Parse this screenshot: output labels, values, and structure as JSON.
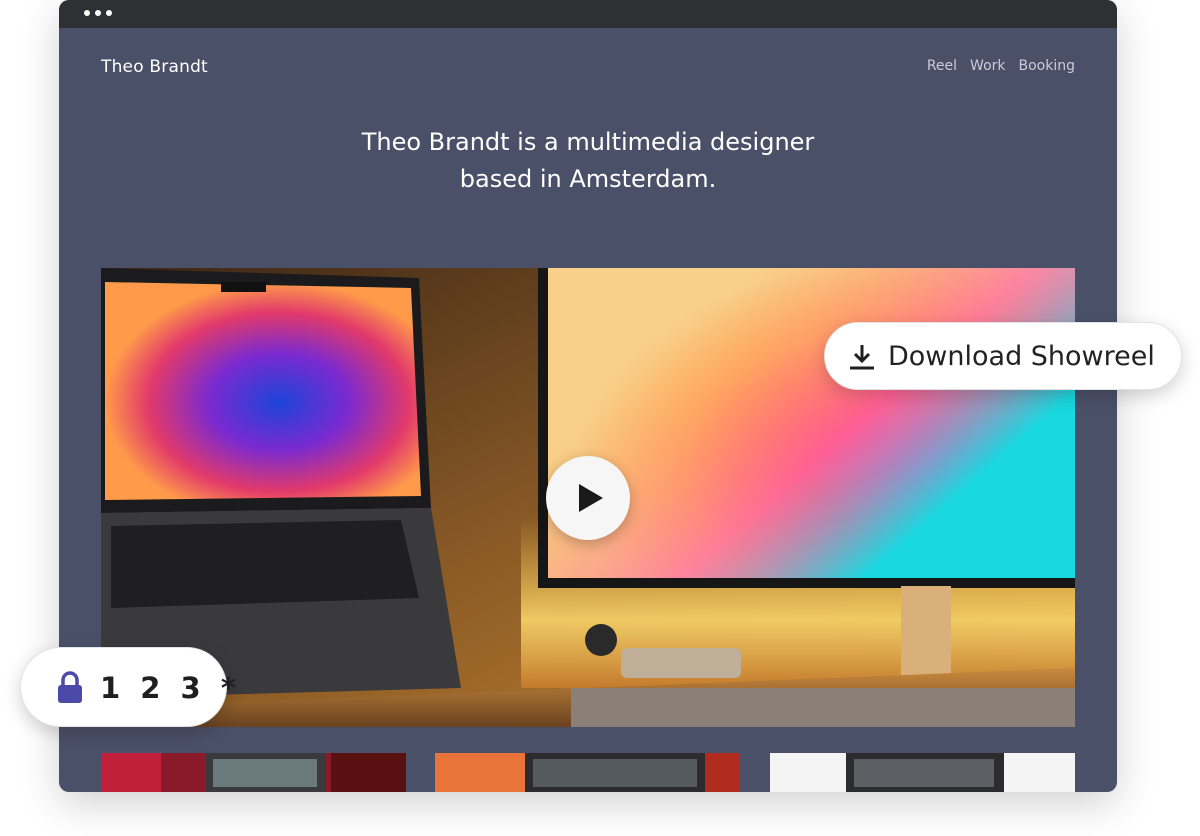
{
  "site": {
    "name": "Theo Brandt",
    "nav": [
      {
        "label": "Reel"
      },
      {
        "label": "Work"
      },
      {
        "label": "Booking"
      }
    ]
  },
  "hero": {
    "headline_line1": "Theo Brandt is a multimedia designer",
    "headline_line2": "based in Amsterdam.",
    "play_icon": "play-icon"
  },
  "overlays": {
    "download": {
      "label": "Download Showreel",
      "icon": "download-icon"
    },
    "passcode": {
      "label": "1 2 3 *",
      "icon": "lock-icon",
      "icon_color": "#4b4aa8"
    }
  },
  "colors": {
    "page_bg": "#4a5068",
    "titlebar": "#2f3033",
    "text": "#ffffff",
    "nav_text": "#c8ccd8"
  }
}
